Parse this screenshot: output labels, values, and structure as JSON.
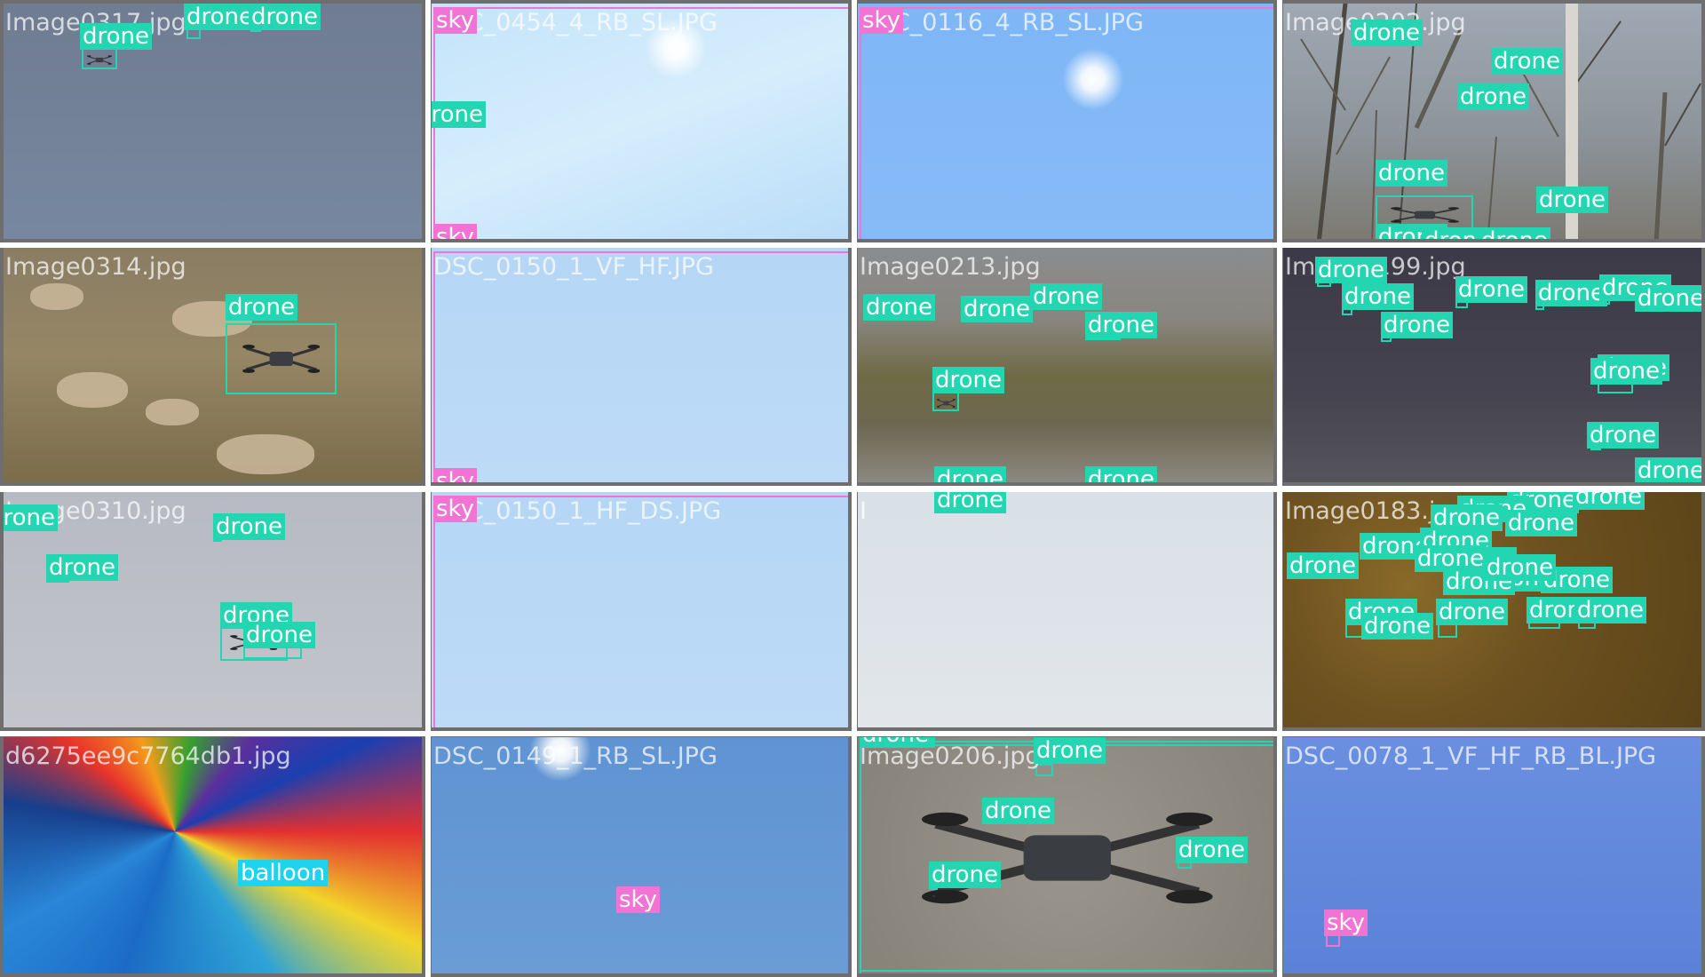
{
  "colors": {
    "drone": "#23d5b1",
    "sky": "#f173d4",
    "balloon": "#1fd3ef"
  },
  "tiles": [
    {
      "file": "Image0317.jpg",
      "scene": "gray-sky"
    },
    {
      "file": "DSC_0454_4_RB_SL.JPG",
      "scene": "light-sky"
    },
    {
      "file": "DSC_0116_4_RB_SL.JPG",
      "scene": "blue-sky"
    },
    {
      "file": "Image0202.jpg",
      "scene": "trees"
    },
    {
      "file": "Image0314.jpg",
      "scene": "rocky-grass"
    },
    {
      "file": "DSC_0150_1_VF_HF.JPG",
      "scene": "pale-sky"
    },
    {
      "file": "Image0213.jpg",
      "scene": "field"
    },
    {
      "file": "Image0199.jpg",
      "scene": "dark"
    },
    {
      "file": "Image0310.jpg",
      "scene": "overcast"
    },
    {
      "file": "DSC_0150_1_HF_DS.JPG",
      "scene": "pale-sky"
    },
    {
      "file": "I",
      "scene": "haze"
    },
    {
      "file": "Image0183.jpg",
      "scene": "brown-grass"
    },
    {
      "file": "d6275ee9c7764db1.jpg",
      "scene": "balloon"
    },
    {
      "file": "DSC_0149_1_RB_SL.JPG",
      "scene": "mid-blue"
    },
    {
      "file": "Image0206.jpg",
      "scene": "gravel"
    },
    {
      "file": "DSC_0078_1_VF_HF_RB_BL.JPG",
      "scene": "deep-blue"
    }
  ],
  "detections": [
    {
      "tile": 0,
      "label": "drone",
      "object": "quadcopter"
    },
    {
      "tile": 0,
      "label": "drone"
    },
    {
      "tile": 0,
      "label": "drone"
    },
    {
      "tile": 1,
      "label": "drone"
    },
    {
      "tile": 1,
      "label": "sky"
    },
    {
      "tile": 1,
      "label": "sky"
    },
    {
      "tile": 2,
      "label": "sky"
    },
    {
      "tile": 3,
      "label": "drone"
    },
    {
      "tile": 3,
      "label": "drone"
    },
    {
      "tile": 3,
      "label": "drone"
    },
    {
      "tile": 3,
      "label": "drone",
      "object": "quadcopter"
    },
    {
      "tile": 3,
      "label": "drone"
    },
    {
      "tile": 3,
      "label": "drone"
    },
    {
      "tile": 3,
      "label": "drone"
    },
    {
      "tile": 3,
      "label": "drone"
    },
    {
      "tile": 4,
      "label": "drone",
      "object": "quadcopter"
    },
    {
      "tile": 5,
      "label": "sky"
    },
    {
      "tile": 6,
      "label": "drone"
    },
    {
      "tile": 6,
      "label": "drone"
    },
    {
      "tile": 6,
      "label": "drone"
    },
    {
      "tile": 6,
      "label": "drone"
    },
    {
      "tile": 6,
      "label": "drone",
      "object": "quadcopter"
    },
    {
      "tile": 6,
      "label": "drone"
    },
    {
      "tile": 6,
      "label": "drone"
    },
    {
      "tile": 7,
      "label": "drone"
    },
    {
      "tile": 7,
      "label": "drone"
    },
    {
      "tile": 7,
      "label": "drone"
    },
    {
      "tile": 7,
      "label": "drone"
    },
    {
      "tile": 7,
      "label": "drone"
    },
    {
      "tile": 7,
      "label": "drone"
    },
    {
      "tile": 7,
      "label": "drone"
    },
    {
      "tile": 7,
      "label": "drone"
    },
    {
      "tile": 7,
      "label": "drone"
    },
    {
      "tile": 7,
      "label": "drone"
    },
    {
      "tile": 7,
      "label": "drone"
    },
    {
      "tile": 8,
      "label": "drone"
    },
    {
      "tile": 8,
      "label": "drone"
    },
    {
      "tile": 8,
      "label": "drone"
    },
    {
      "tile": 8,
      "label": "drone",
      "object": "quadcopter"
    },
    {
      "tile": 8,
      "label": "drone"
    },
    {
      "tile": 9,
      "label": "sky"
    },
    {
      "tile": 10,
      "label": "drone"
    },
    {
      "tile": 11,
      "label": "drone"
    },
    {
      "tile": 11,
      "label": "drone"
    },
    {
      "tile": 11,
      "label": "drone"
    },
    {
      "tile": 11,
      "label": "drone"
    },
    {
      "tile": 11,
      "label": "drone"
    },
    {
      "tile": 11,
      "label": "drone"
    },
    {
      "tile": 11,
      "label": "drone"
    },
    {
      "tile": 11,
      "label": "drone"
    },
    {
      "tile": 11,
      "label": "drone"
    },
    {
      "tile": 11,
      "label": "drone"
    },
    {
      "tile": 11,
      "label": "drone"
    },
    {
      "tile": 11,
      "label": "drone"
    },
    {
      "tile": 11,
      "label": "drone"
    },
    {
      "tile": 11,
      "label": "drone"
    },
    {
      "tile": 11,
      "label": "drone"
    },
    {
      "tile": 11,
      "label": "drone"
    },
    {
      "tile": 11,
      "label": "drone"
    },
    {
      "tile": 11,
      "label": "drone"
    },
    {
      "tile": 11,
      "label": "drone"
    },
    {
      "tile": 12,
      "label": "balloon"
    },
    {
      "tile": 13,
      "label": "sky"
    },
    {
      "tile": 14,
      "label": "drone",
      "object": "quadcopter"
    },
    {
      "tile": 14,
      "label": "drone"
    },
    {
      "tile": 14,
      "label": "drone"
    },
    {
      "tile": 14,
      "label": "drone"
    },
    {
      "tile": 14,
      "label": "drone"
    },
    {
      "tile": 14,
      "label": "drone",
      "object": "quadcopter"
    },
    {
      "tile": 15,
      "label": "sky"
    }
  ]
}
